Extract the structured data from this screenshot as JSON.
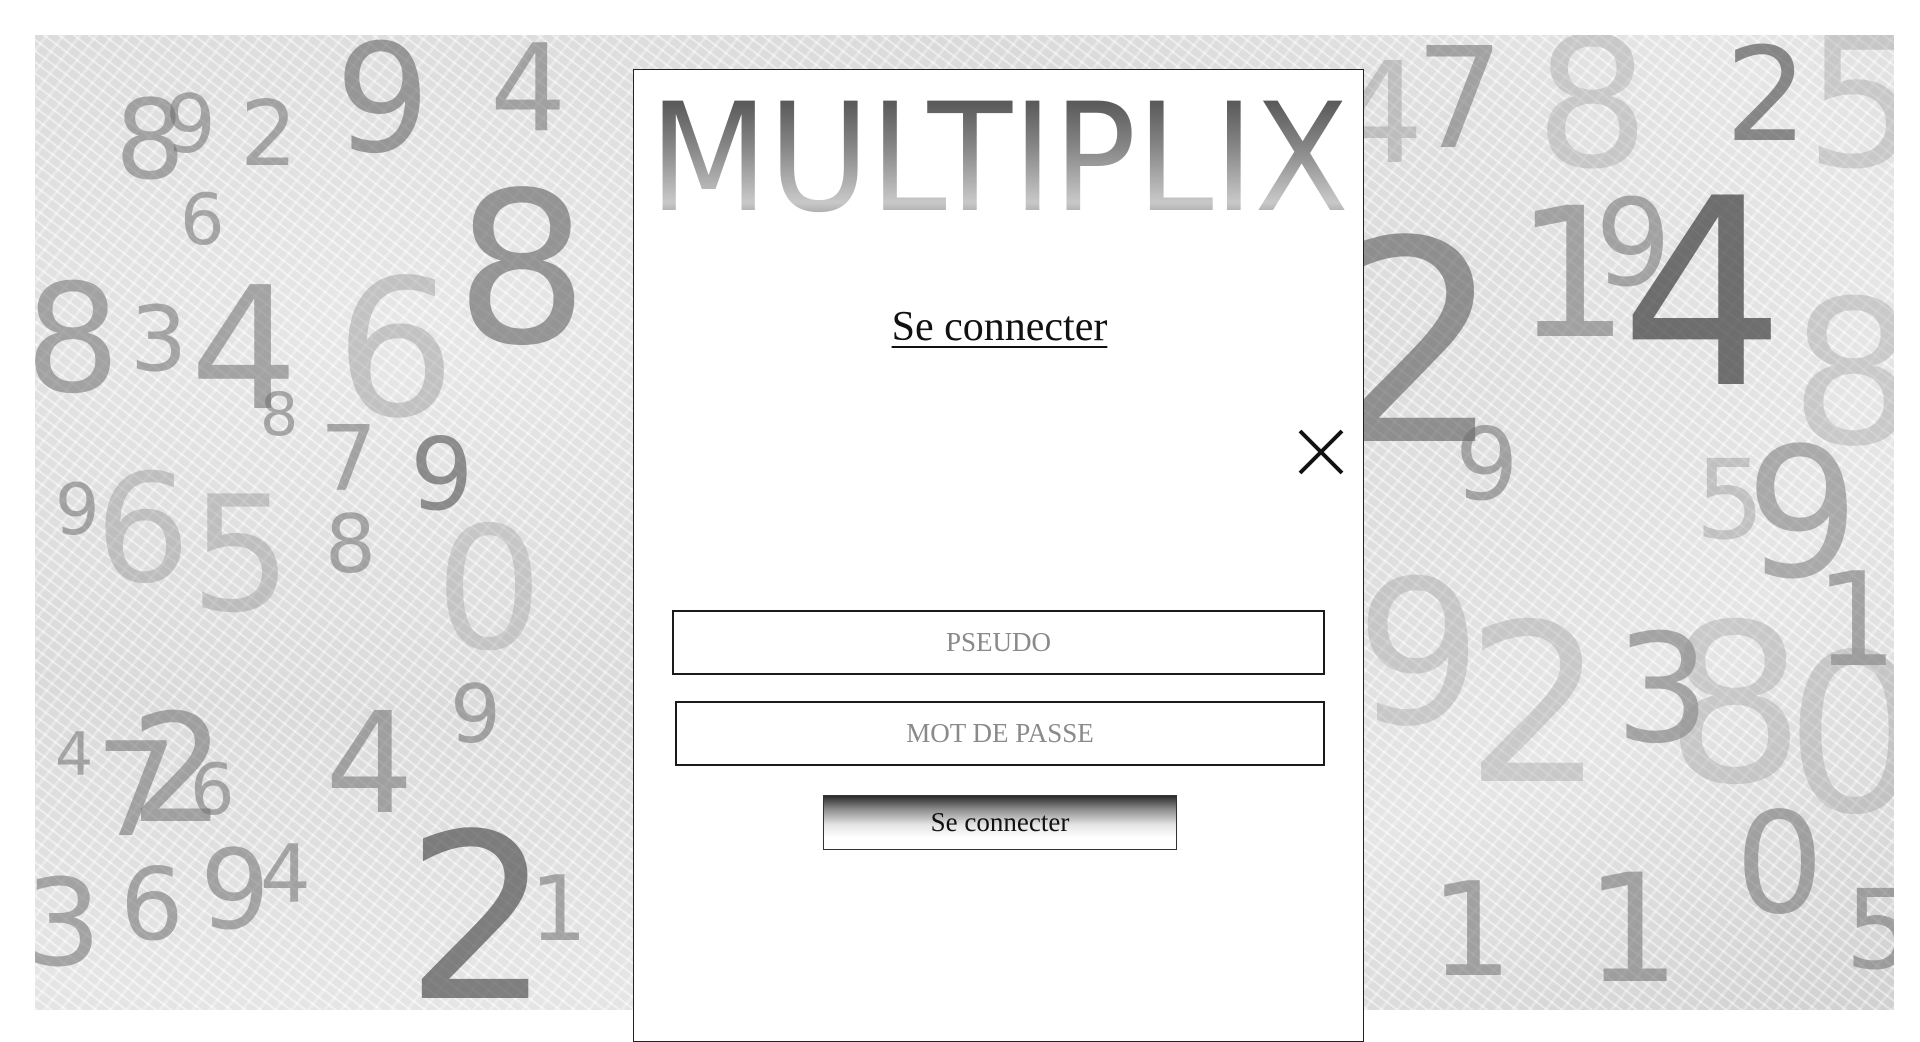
{
  "app": {
    "logo_text": "MULTIPLIX"
  },
  "dialog": {
    "title": "Se connecter",
    "close_icon": "close-icon",
    "pseudo_placeholder": "PSEUDO",
    "password_placeholder": "MOT DE PASSE",
    "submit_label": "Se connecter"
  },
  "background": {
    "theme": "crumpled paper with scattered grey numbers"
  },
  "colors": {
    "panel": "#ffffff",
    "text": "#111111",
    "placeholder": "#8a8a8a",
    "border": "#1a1a1a"
  }
}
